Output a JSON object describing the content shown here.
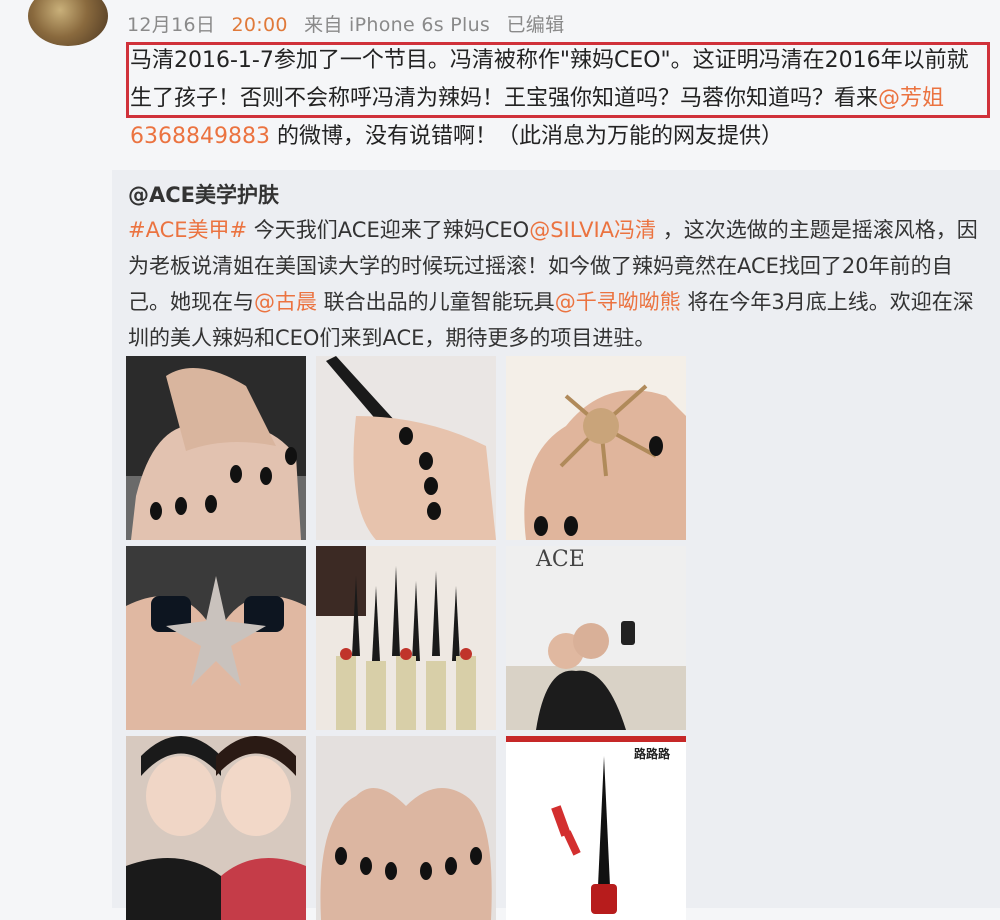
{
  "post": {
    "date": "12月16日",
    "time": "20:00",
    "source": "来自 iPhone 6s Plus",
    "edited": "已编辑",
    "text_1": "马清2016-1-7参加了一个节目。冯清被称作\"辣妈CEO\"。这证明冯清在2016年以前就生了孩子！否则不会称呼冯清为辣妈！王宝强你知道吗？马蓉你知道吗？看来",
    "mention": "@芳姐6368849883",
    "text_2": " 的微博，没有说错啊！（此消息为万能的网友提供）"
  },
  "repost": {
    "author": "@ACE美学护肤",
    "tag": "#ACE美甲#",
    "text_1": " 今天我们ACE迎来了辣妈CEO",
    "at_1": "@SILVIA冯清",
    "text_2": " ，这次选做的主题是摇滚风格，因为老板说清姐在美国读大学的时候玩过摇滚！如今做了辣妈竟然在ACE找回了20年前的自己。她现在与",
    "at_2": "@古晨",
    "text_3": " 联合出品的儿童智能玩具",
    "at_3": "@千寻呦呦熊",
    "text_4": " 将在今年3月底上线。欢迎在深圳的美人辣妈和CEO们来到ACE，期待更多的项目进驻。"
  },
  "images": {
    "ace_logo_text": "ACE",
    "poster_title": "路路路",
    "items": [
      "photo-1",
      "photo-2",
      "photo-3",
      "photo-4",
      "photo-5",
      "photo-6",
      "photo-7",
      "photo-8",
      "photo-9"
    ]
  },
  "colors": {
    "highlight_border": "#d0313a",
    "link": "#eb7340",
    "time": "#e07a3a",
    "meta": "#8a8a8a"
  }
}
